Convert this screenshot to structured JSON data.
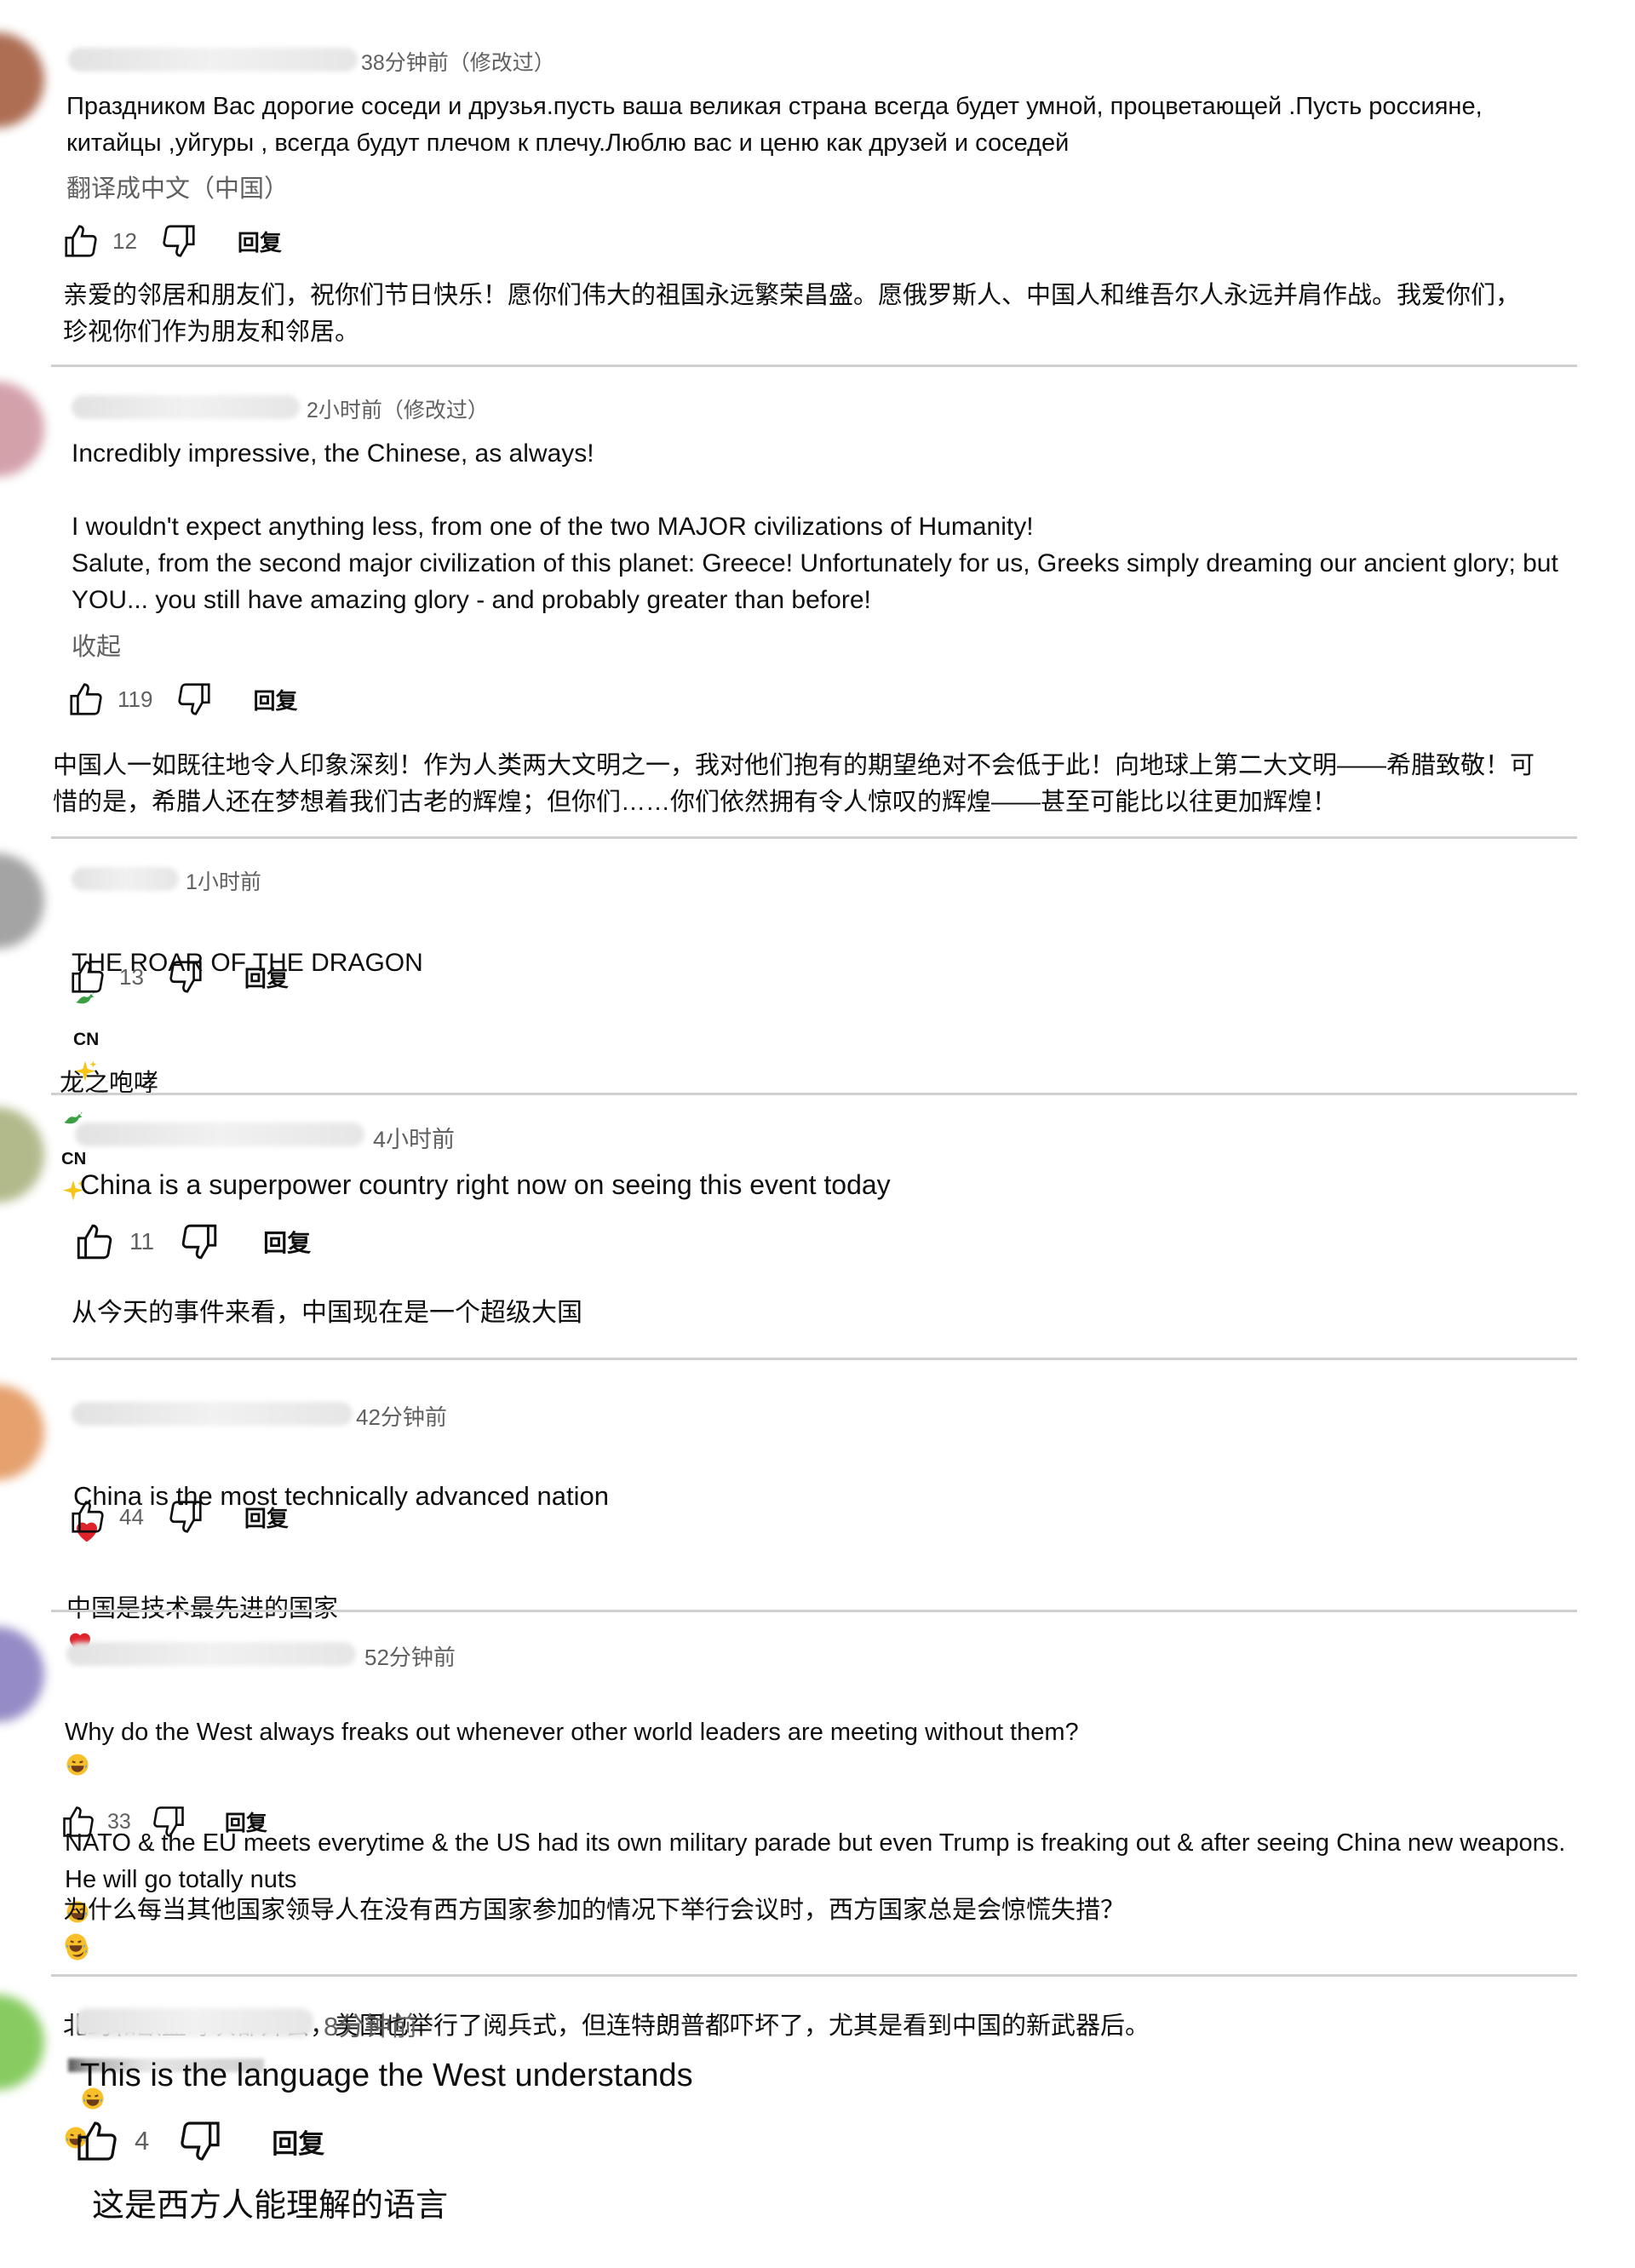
{
  "comments": [
    {
      "time": "38分钟前（修改过）",
      "text": "Праздником Вас дорогие соседи и друзья.пусть ваша великая страна всегда будет умной, процветающей .Пусть россияне,\nкитайцы ,уйгуры , всегда будут плечом к плечу.Люблю вас и ценю как друзей и соседей",
      "link": "翻译成中文（中国）",
      "likes": "12",
      "reply": "回复",
      "translation": "亲爱的邻居和朋友们，祝你们节日快乐！愿你们伟大的祖国永远繁荣昌盛。愿俄罗斯人、中国人和维吾尔人永远并肩作战。我爱你们，\n珍视你们作为朋友和邻居。"
    },
    {
      "time": "2小时前（修改过）",
      "text": "Incredibly impressive, the Chinese, as always!\n\nI wouldn't expect anything less, from one of the two MAJOR civilizations of Humanity!\nSalute, from the second major civilization of this planet: Greece! Unfortunately for us, Greeks simply dreaming our ancient glory; but\nYOU... you still have amazing glory - and probably greater than before!",
      "link": "收起",
      "likes": "119",
      "reply": "回复",
      "translation": "中国人一如既往地令人印象深刻！作为人类两大文明之一，我对他们抱有的期望绝对不会低于此！向地球上第二大文明——希腊致敬！可\n惜的是，希腊人还在梦想着我们古老的辉煌；但你们……你们依然拥有令人惊叹的辉煌——甚至可能比以往更加辉煌！"
    },
    {
      "time": "1小时前",
      "text": "THE ROAR OF THE DRAGON",
      "flag": "CN",
      "likes": "13",
      "reply": "回复",
      "translation": "龙之咆哮"
    },
    {
      "time": "4小时前",
      "text": "China is a superpower country right now on seeing this event today",
      "likes": "11",
      "reply": "回复",
      "translation": "从今天的事件来看，中国现在是一个超级大国"
    },
    {
      "time": "42分钟前",
      "text": "China is the most technically advanced nation",
      "likes": "44",
      "reply": "回复",
      "translation": "中国是技术最先进的国家"
    },
    {
      "time": "52分钟前",
      "text_line1": "Why do the West always freaks out whenever other world leaders are meeting without them?",
      "text_rest": "NATO & the EU meets everytime & the US had its own military parade but even Trump is freaking out & after seeing China new weapons.\nHe will go totally nuts",
      "likes": "33",
      "reply": "回复",
      "translation_line1": "为什么每当其他国家领导人在没有西方国家参加的情况下举行会议时，西方国家总是会惊慌失措？",
      "translation_line2": "北约和欧盟每次都开会，美国也举行了阅兵式，但连特朗普都吓坏了，尤其是看到中国的新武器后。"
    },
    {
      "time": "8分钟前",
      "text": "This is the language the West understands",
      "likes": "4",
      "reply": "回复",
      "translation": "这是西方人能理解的语言"
    }
  ]
}
